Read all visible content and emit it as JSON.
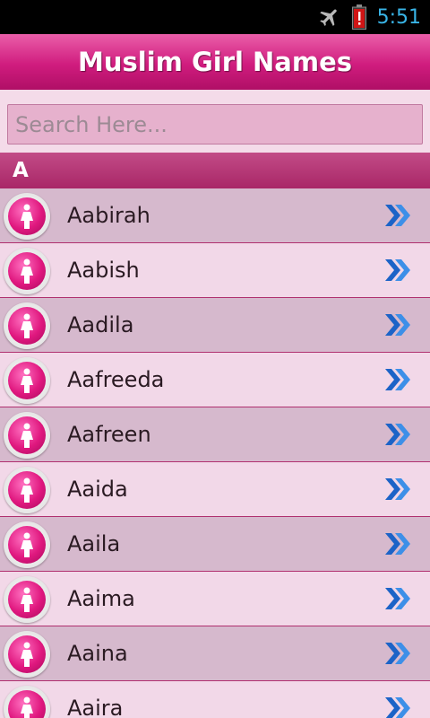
{
  "status_bar": {
    "time": "5:51"
  },
  "header": {
    "title": "Muslim Girl Names"
  },
  "search": {
    "placeholder": "Search Here..."
  },
  "section": {
    "letter": "A"
  },
  "names": [
    {
      "label": "Aabirah"
    },
    {
      "label": "Aabish"
    },
    {
      "label": "Aadila"
    },
    {
      "label": "Aafreeda"
    },
    {
      "label": "Aafreen"
    },
    {
      "label": "Aaida"
    },
    {
      "label": "Aaila"
    },
    {
      "label": "Aaima"
    },
    {
      "label": "Aaina"
    },
    {
      "label": "Aaira"
    }
  ],
  "icons": {
    "avatar": "female-icon",
    "row_action": "double-chevron-right-icon",
    "status": [
      "airplane-icon",
      "battery-alert-icon"
    ]
  },
  "colors": {
    "header": "#d01c7e",
    "section": "#b03372",
    "row_dark": "#d6b9cd",
    "row_light": "#f2d8e8",
    "clock": "#39b4e6",
    "chevron": "#1c63c7"
  }
}
